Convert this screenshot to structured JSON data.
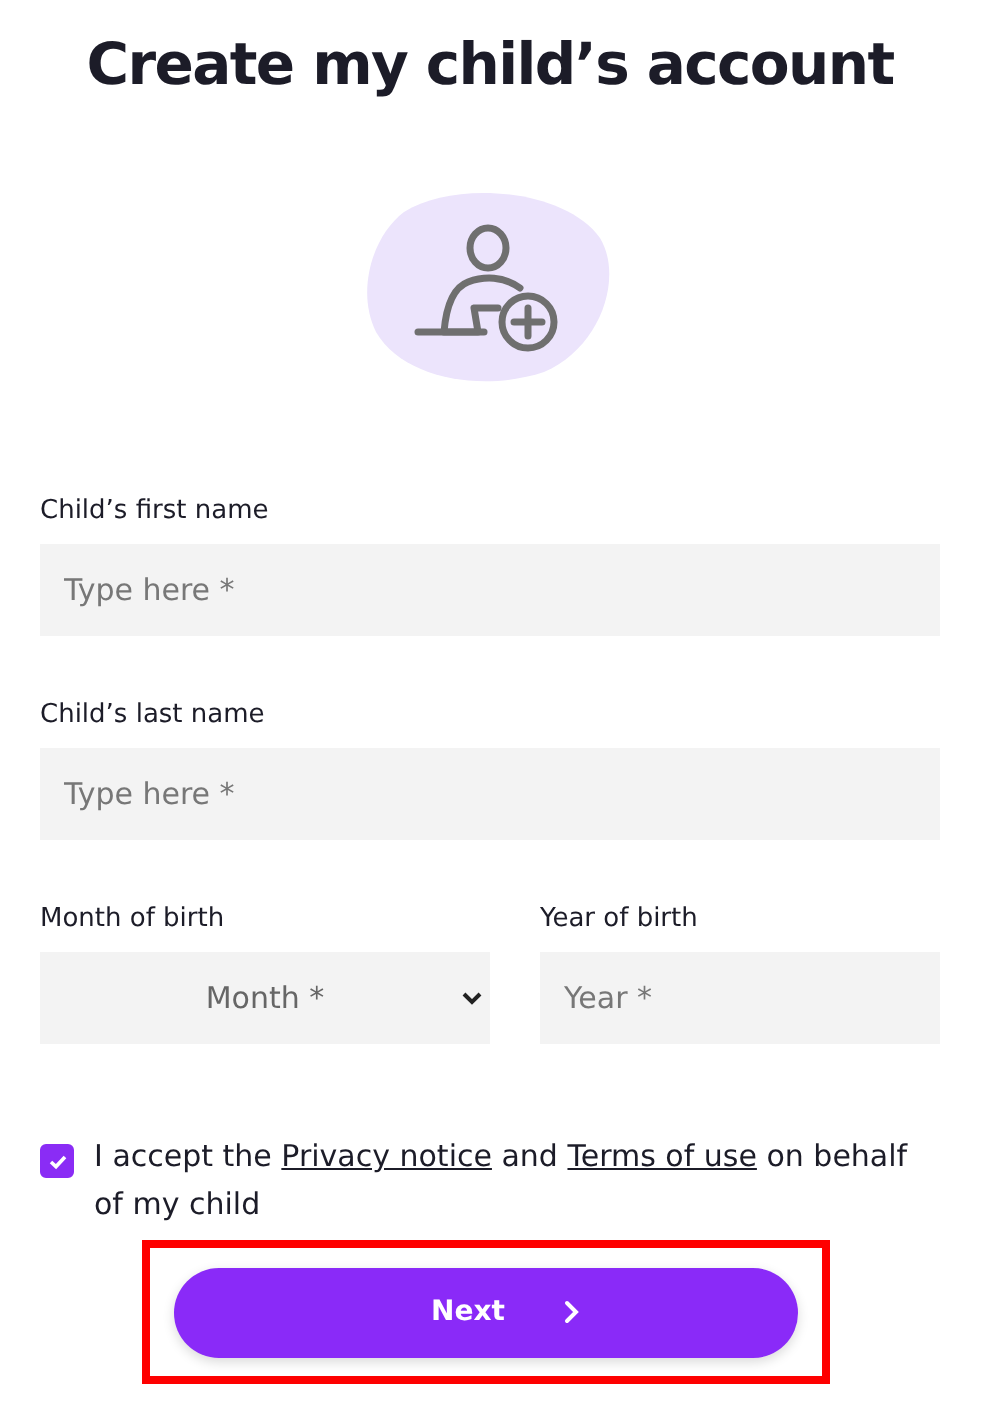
{
  "title": "Create my child’s account",
  "fields": [
    {
      "label": "Child’s first name",
      "placeholder": "Type here *"
    },
    {
      "label": "Child’s last name",
      "placeholder": "Type here *"
    }
  ],
  "birth": [
    {
      "kind": "select",
      "label": "Month of birth",
      "placeholder": "Month *"
    },
    {
      "kind": "input",
      "label": "Year of birth",
      "placeholder": "Year *"
    }
  ],
  "consent": {
    "checked": true,
    "parts": [
      {
        "kind": "text",
        "text": "I accept the "
      },
      {
        "kind": "link",
        "text": "Privacy notice"
      },
      {
        "kind": "text",
        "text": " and "
      },
      {
        "kind": "link",
        "text": "Terms of use"
      },
      {
        "kind": "text",
        "text": " on behalf of my child"
      }
    ]
  },
  "next_button": {
    "label": "Next",
    "highlighted": true
  }
}
